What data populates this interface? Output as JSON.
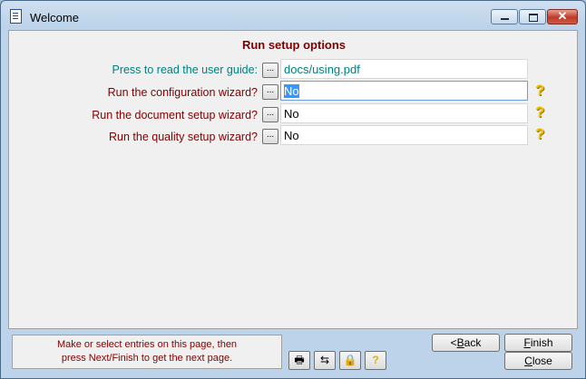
{
  "window": {
    "title": "Welcome"
  },
  "titlebar": {
    "minimize_icon": "minimize-icon",
    "maximize_icon": "maximize-icon",
    "close_glyph": "✕"
  },
  "heading": "Run setup options",
  "rows": [
    {
      "label": "Press to read the user guide:",
      "button": "...",
      "value": "docs/using.pdf"
    },
    {
      "label": "Run the configuration wizard?",
      "button": "...",
      "value": "No"
    },
    {
      "label": "Run the document setup wizard?",
      "button": "...",
      "value": "No"
    },
    {
      "label": "Run the quality setup wizard?",
      "button": "...",
      "value": "No"
    }
  ],
  "help_glyph": "?",
  "footer": {
    "hint_line1": "Make or select entries on this page, then",
    "hint_line2": "press Next/Finish to get the next page.",
    "tools": [
      {
        "icon": "printer-icon",
        "glyph": "🖶"
      },
      {
        "icon": "compare-pages-icon",
        "glyph": "⇆"
      },
      {
        "icon": "lock-icon",
        "glyph": "🔒"
      },
      {
        "icon": "help-icon",
        "glyph": "?"
      }
    ],
    "back_prefix": "<",
    "back_mnemonic": "B",
    "back_rest": "ack",
    "finish_mnemonic": "F",
    "finish_rest": "inish",
    "close_mnemonic": "C",
    "close_rest": "lose"
  },
  "colors": {
    "label_link": "#008080",
    "label_text": "#800000",
    "selection": "#3399ff"
  }
}
